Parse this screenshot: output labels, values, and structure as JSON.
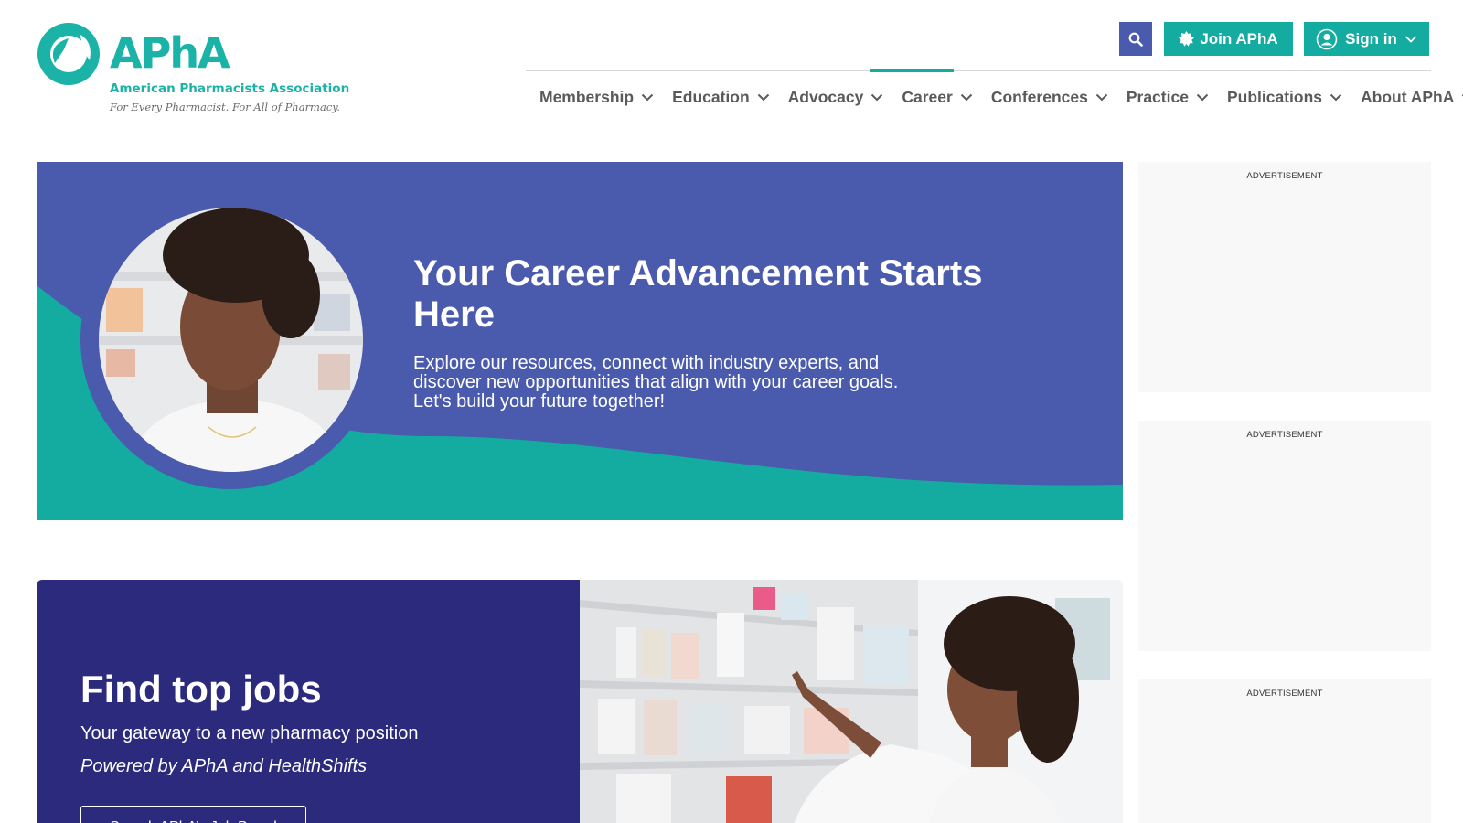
{
  "header": {
    "logo": {
      "wordmark": "APhA",
      "org_name": "American Pharmacists Association",
      "tagline": "For Every Pharmacist. For All of Pharmacy."
    },
    "search_icon": "search-icon",
    "join_label": "Join APhA",
    "signin_label": "Sign in",
    "colors": {
      "teal": "#14aca0",
      "indigo": "#4a5aad",
      "nav_text": "#5a5a5a"
    }
  },
  "nav": {
    "active": "Career",
    "items": [
      {
        "label": "Membership"
      },
      {
        "label": "Education"
      },
      {
        "label": "Advocacy"
      },
      {
        "label": "Career"
      },
      {
        "label": "Conferences"
      },
      {
        "label": "Practice"
      },
      {
        "label": "Publications"
      },
      {
        "label": "About APhA"
      }
    ]
  },
  "hero": {
    "title": "Your Career Advancement Starts Here",
    "text": "Explore our resources, connect with industry experts, and discover new opportunities that align with your career goals. Let's build your future together!",
    "colors": {
      "background": "#4a5aad",
      "wave": "#14aca0"
    }
  },
  "jobs": {
    "title": "Find top jobs",
    "subtitle": "Your gateway to a new pharmacy position",
    "powered_by": "Powered by APhA and HealthShifts",
    "button_label": "Search APhA’s Job Board",
    "colors": {
      "background": "#2c2a7c"
    }
  },
  "ads": [
    {
      "label": "ADVERTISEMENT"
    },
    {
      "label": "ADVERTISEMENT"
    },
    {
      "label": "ADVERTISEMENT"
    }
  ]
}
